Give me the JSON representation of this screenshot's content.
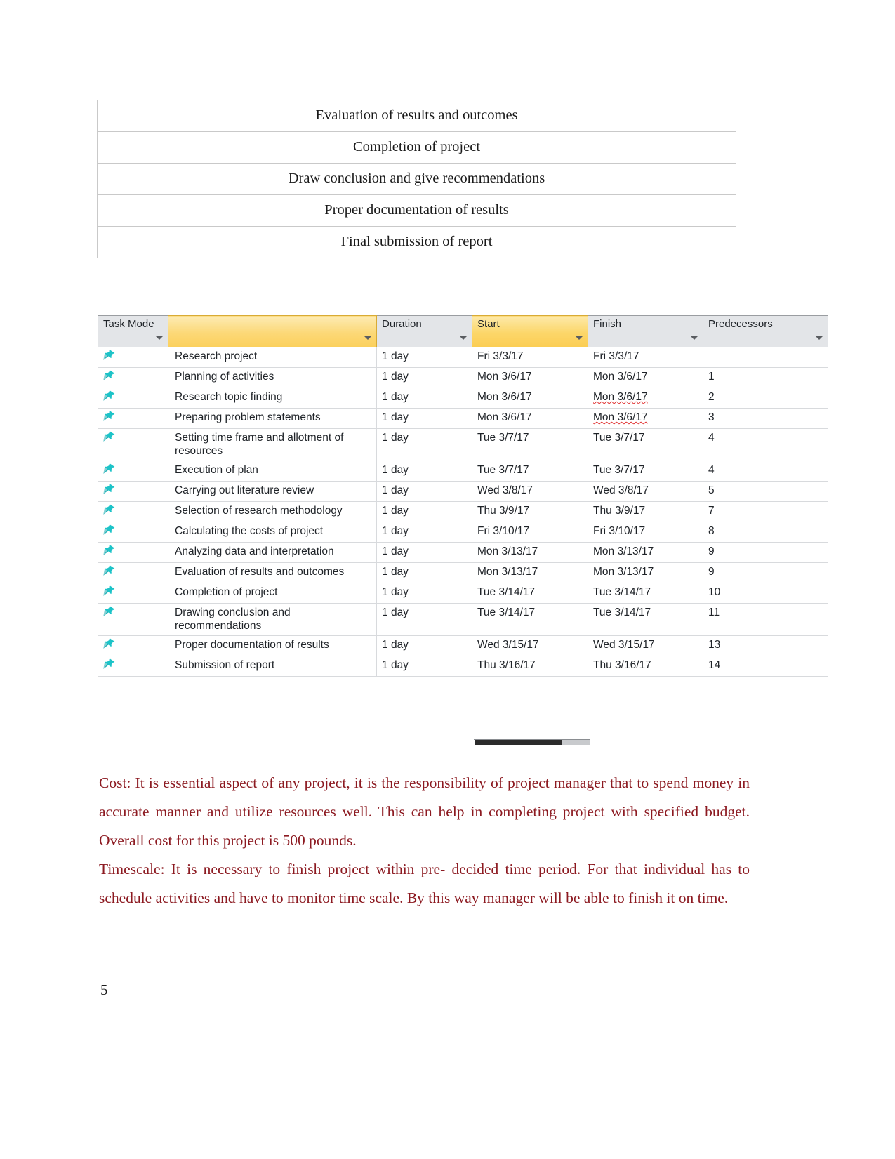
{
  "document": {
    "page_number": "5"
  },
  "outcome_table": {
    "rows": [
      "Evaluation of results and outcomes",
      "Completion of project",
      "Draw conclusion and give recommendations",
      "Proper documentation of results",
      "Final submission of report"
    ]
  },
  "project_grid": {
    "columns": [
      {
        "key": "task_mode",
        "label": "Task Mode",
        "style": "grey"
      },
      {
        "key": "task_name",
        "label": "",
        "style": "gold-blank"
      },
      {
        "key": "duration",
        "label": "Duration",
        "style": "grey"
      },
      {
        "key": "start",
        "label": "Start",
        "style": "gold"
      },
      {
        "key": "finish",
        "label": "Finish",
        "style": "grey"
      },
      {
        "key": "predecessors",
        "label": "Predecessors",
        "style": "grey"
      }
    ],
    "icons": {
      "task_mode": "pushpin-icon",
      "column_filter": "chevron-down-icon"
    },
    "rows": [
      {
        "mode": "pushpin-icon",
        "name": "Research project",
        "duration": "1 day",
        "start": "Fri 3/3/17",
        "finish": "Fri 3/3/17",
        "finish_flagged": false,
        "predecessors": ""
      },
      {
        "mode": "pushpin-icon",
        "name": "Planning of activities",
        "duration": "1 day",
        "start": "Mon 3/6/17",
        "finish": "Mon 3/6/17",
        "finish_flagged": false,
        "predecessors": "1"
      },
      {
        "mode": "pushpin-icon",
        "name": "Research topic finding",
        "duration": "1 day",
        "start": "Mon 3/6/17",
        "finish": "Mon 3/6/17",
        "finish_flagged": true,
        "predecessors": "2"
      },
      {
        "mode": "pushpin-icon",
        "name": "Preparing problem statements",
        "duration": "1 day",
        "start": "Mon 3/6/17",
        "finish": "Mon 3/6/17",
        "finish_flagged": true,
        "predecessors": "3"
      },
      {
        "mode": "pushpin-icon",
        "name": "Setting time frame and allotment of resources",
        "duration": "1 day",
        "start": "Tue 3/7/17",
        "finish": "Tue 3/7/17",
        "finish_flagged": false,
        "predecessors": "4"
      },
      {
        "mode": "pushpin-icon",
        "name": "Execution of plan",
        "duration": "1 day",
        "start": "Tue 3/7/17",
        "finish": "Tue 3/7/17",
        "finish_flagged": false,
        "predecessors": "4"
      },
      {
        "mode": "pushpin-icon",
        "name": "Carrying out literature review",
        "duration": "1 day",
        "start": "Wed 3/8/17",
        "finish": "Wed 3/8/17",
        "finish_flagged": false,
        "predecessors": "5"
      },
      {
        "mode": "pushpin-icon",
        "name": "Selection of research methodology",
        "duration": "1 day",
        "start": "Thu 3/9/17",
        "finish": "Thu 3/9/17",
        "finish_flagged": false,
        "predecessors": "7"
      },
      {
        "mode": "pushpin-icon",
        "name": "Calculating the costs of project",
        "duration": "1 day",
        "start": "Fri 3/10/17",
        "finish": "Fri 3/10/17",
        "finish_flagged": false,
        "predecessors": "8"
      },
      {
        "mode": "pushpin-icon",
        "name": "Analyzing data and interpretation",
        "duration": "1 day",
        "start": "Mon 3/13/17",
        "finish": "Mon 3/13/17",
        "finish_flagged": false,
        "predecessors": "9"
      },
      {
        "mode": "pushpin-icon",
        "name": "Evaluation of results and outcomes",
        "duration": "1 day",
        "start": "Mon 3/13/17",
        "finish": "Mon 3/13/17",
        "finish_flagged": false,
        "predecessors": "9"
      },
      {
        "mode": "pushpin-icon",
        "name": "Completion of project",
        "duration": "1 day",
        "start": "Tue 3/14/17",
        "finish": "Tue 3/14/17",
        "finish_flagged": false,
        "predecessors": "10"
      },
      {
        "mode": "pushpin-icon",
        "name": "Drawing conclusion and recommendations",
        "duration": "1 day",
        "start": "Tue 3/14/17",
        "finish": "Tue 3/14/17",
        "finish_flagged": false,
        "predecessors": "11"
      },
      {
        "mode": "pushpin-icon",
        "name": "Proper documentation of results",
        "duration": "1 day",
        "start": "Wed 3/15/17",
        "finish": "Wed 3/15/17",
        "finish_flagged": false,
        "predecessors": "13"
      },
      {
        "mode": "pushpin-icon",
        "name": "Submission of report",
        "duration": "1 day",
        "start": "Thu 3/16/17",
        "finish": "Thu 3/16/17",
        "finish_flagged": false,
        "predecessors": "14"
      }
    ]
  },
  "body": {
    "text_color": "#8c1a21",
    "paragraphs": [
      {
        "id": "cost",
        "label": "Cost:",
        "text": "Cost: It is essential aspect of any project, it is the responsibility of project manager that to spend money in accurate manner and utilize resources well. This can help in completing project with specified budget. Overall cost for this project is 500 pounds."
      },
      {
        "id": "timescale",
        "label": "Timescale:",
        "text": "Timescale: It is necessary to finish project within pre- decided time period. For that individual has to schedule activities and have to monitor time scale. By this way manager will be able to finish it on time."
      }
    ]
  }
}
